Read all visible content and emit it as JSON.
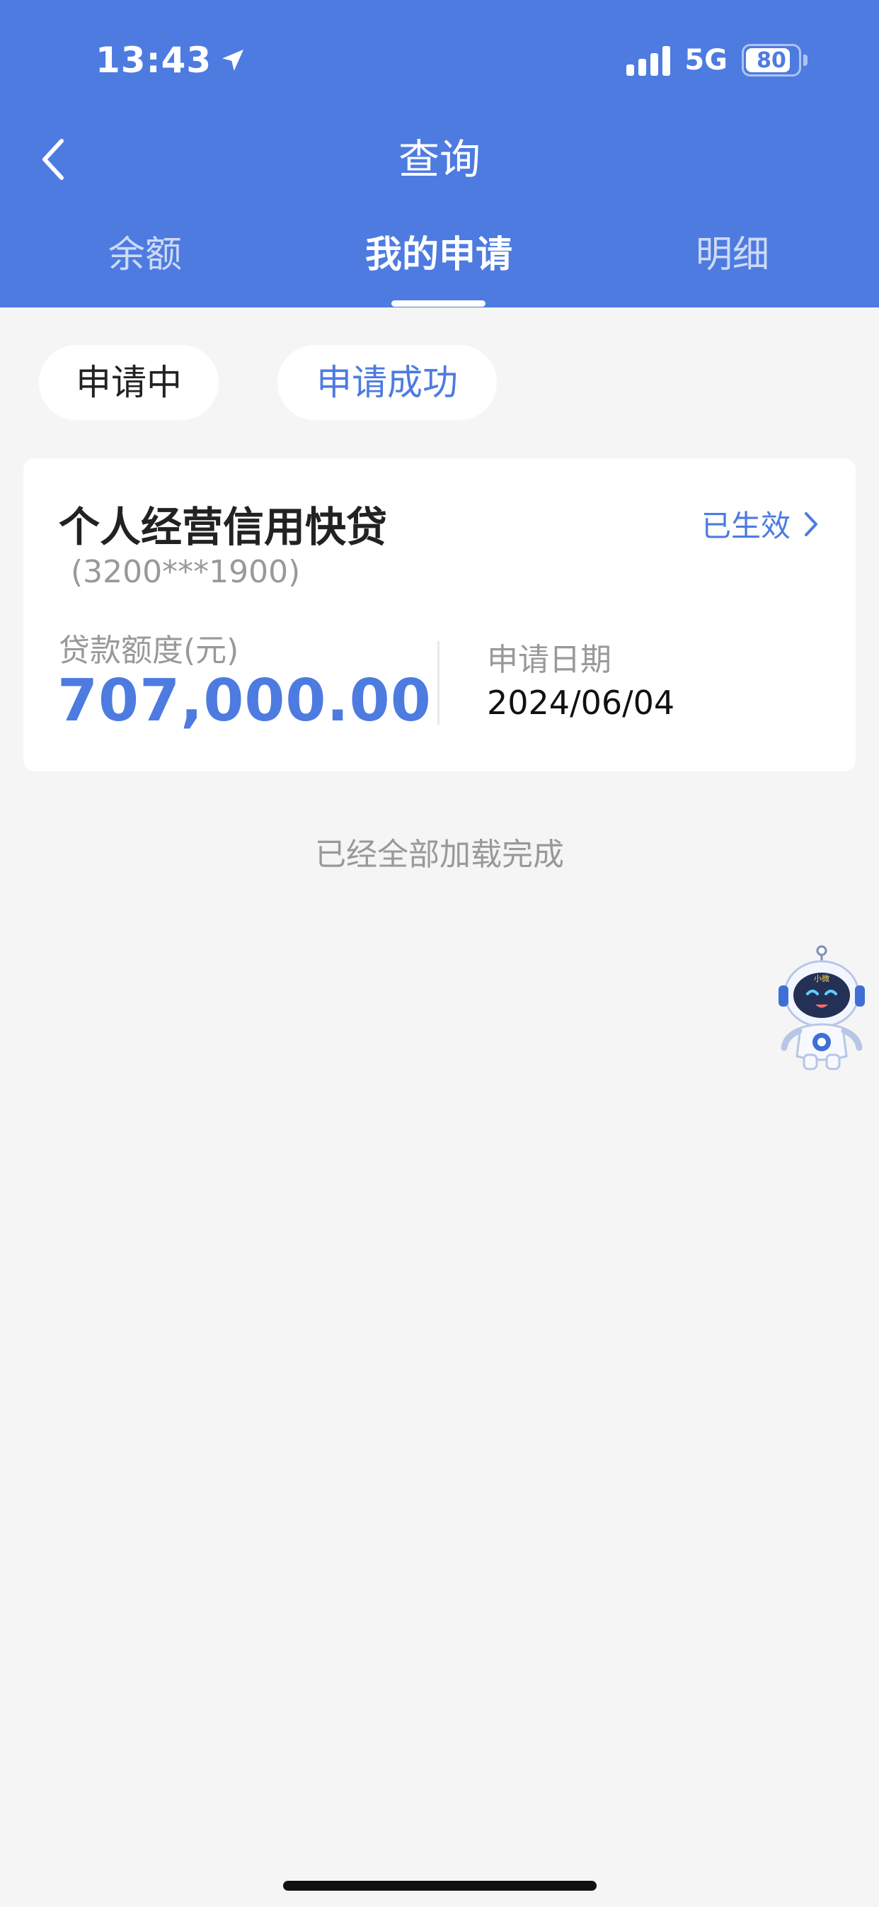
{
  "status_bar": {
    "time": "13:43",
    "network": "5G",
    "battery": "80",
    "battery_level": 0.8
  },
  "nav": {
    "title": "查询"
  },
  "tabs": [
    {
      "label": "余额",
      "active": false
    },
    {
      "label": "我的申请",
      "active": true
    },
    {
      "label": "明细",
      "active": false
    }
  ],
  "filters": {
    "pending": "申请中",
    "success": "申请成功",
    "selected": "success"
  },
  "application": {
    "product_name": "个人经营信用快贷",
    "account": "(3200***1900)",
    "status": "已生效",
    "amount_label": "贷款额度(元)",
    "amount": "707,000.00",
    "date_label": "申请日期",
    "date": "2024/06/04"
  },
  "list_footer": "已经全部加载完成",
  "assistant": {
    "badge": "小微"
  },
  "colors": {
    "accent": "#4d7be0",
    "background": "#f5f5f5"
  }
}
